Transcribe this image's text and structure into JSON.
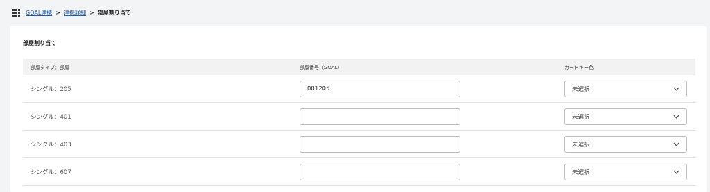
{
  "breadcrumb": {
    "items": [
      "GOAL連携",
      "連携詳細"
    ],
    "separator": ">",
    "current": "部屋割り当て"
  },
  "card": {
    "title": "部屋割り当て"
  },
  "table": {
    "headers": [
      "部屋タイプ：部屋",
      "部屋番号（GOAL）",
      "カードキー色"
    ],
    "rows": [
      {
        "room": "シングル：205",
        "room_number": "001205",
        "card_color": "未選択"
      },
      {
        "room": "シングル：401",
        "room_number": "",
        "card_color": "未選択"
      },
      {
        "room": "シングル：403",
        "room_number": "",
        "card_color": "未選択"
      },
      {
        "room": "シングル：607",
        "room_number": "",
        "card_color": "未選択"
      }
    ]
  },
  "colors": {
    "link": "#1e5aa8",
    "header_bg": "#f2f2f2",
    "page_bg": "#f3f4f6"
  },
  "icons": {
    "menu": "grid-menu-icon",
    "select": "chevron-down-icon"
  }
}
